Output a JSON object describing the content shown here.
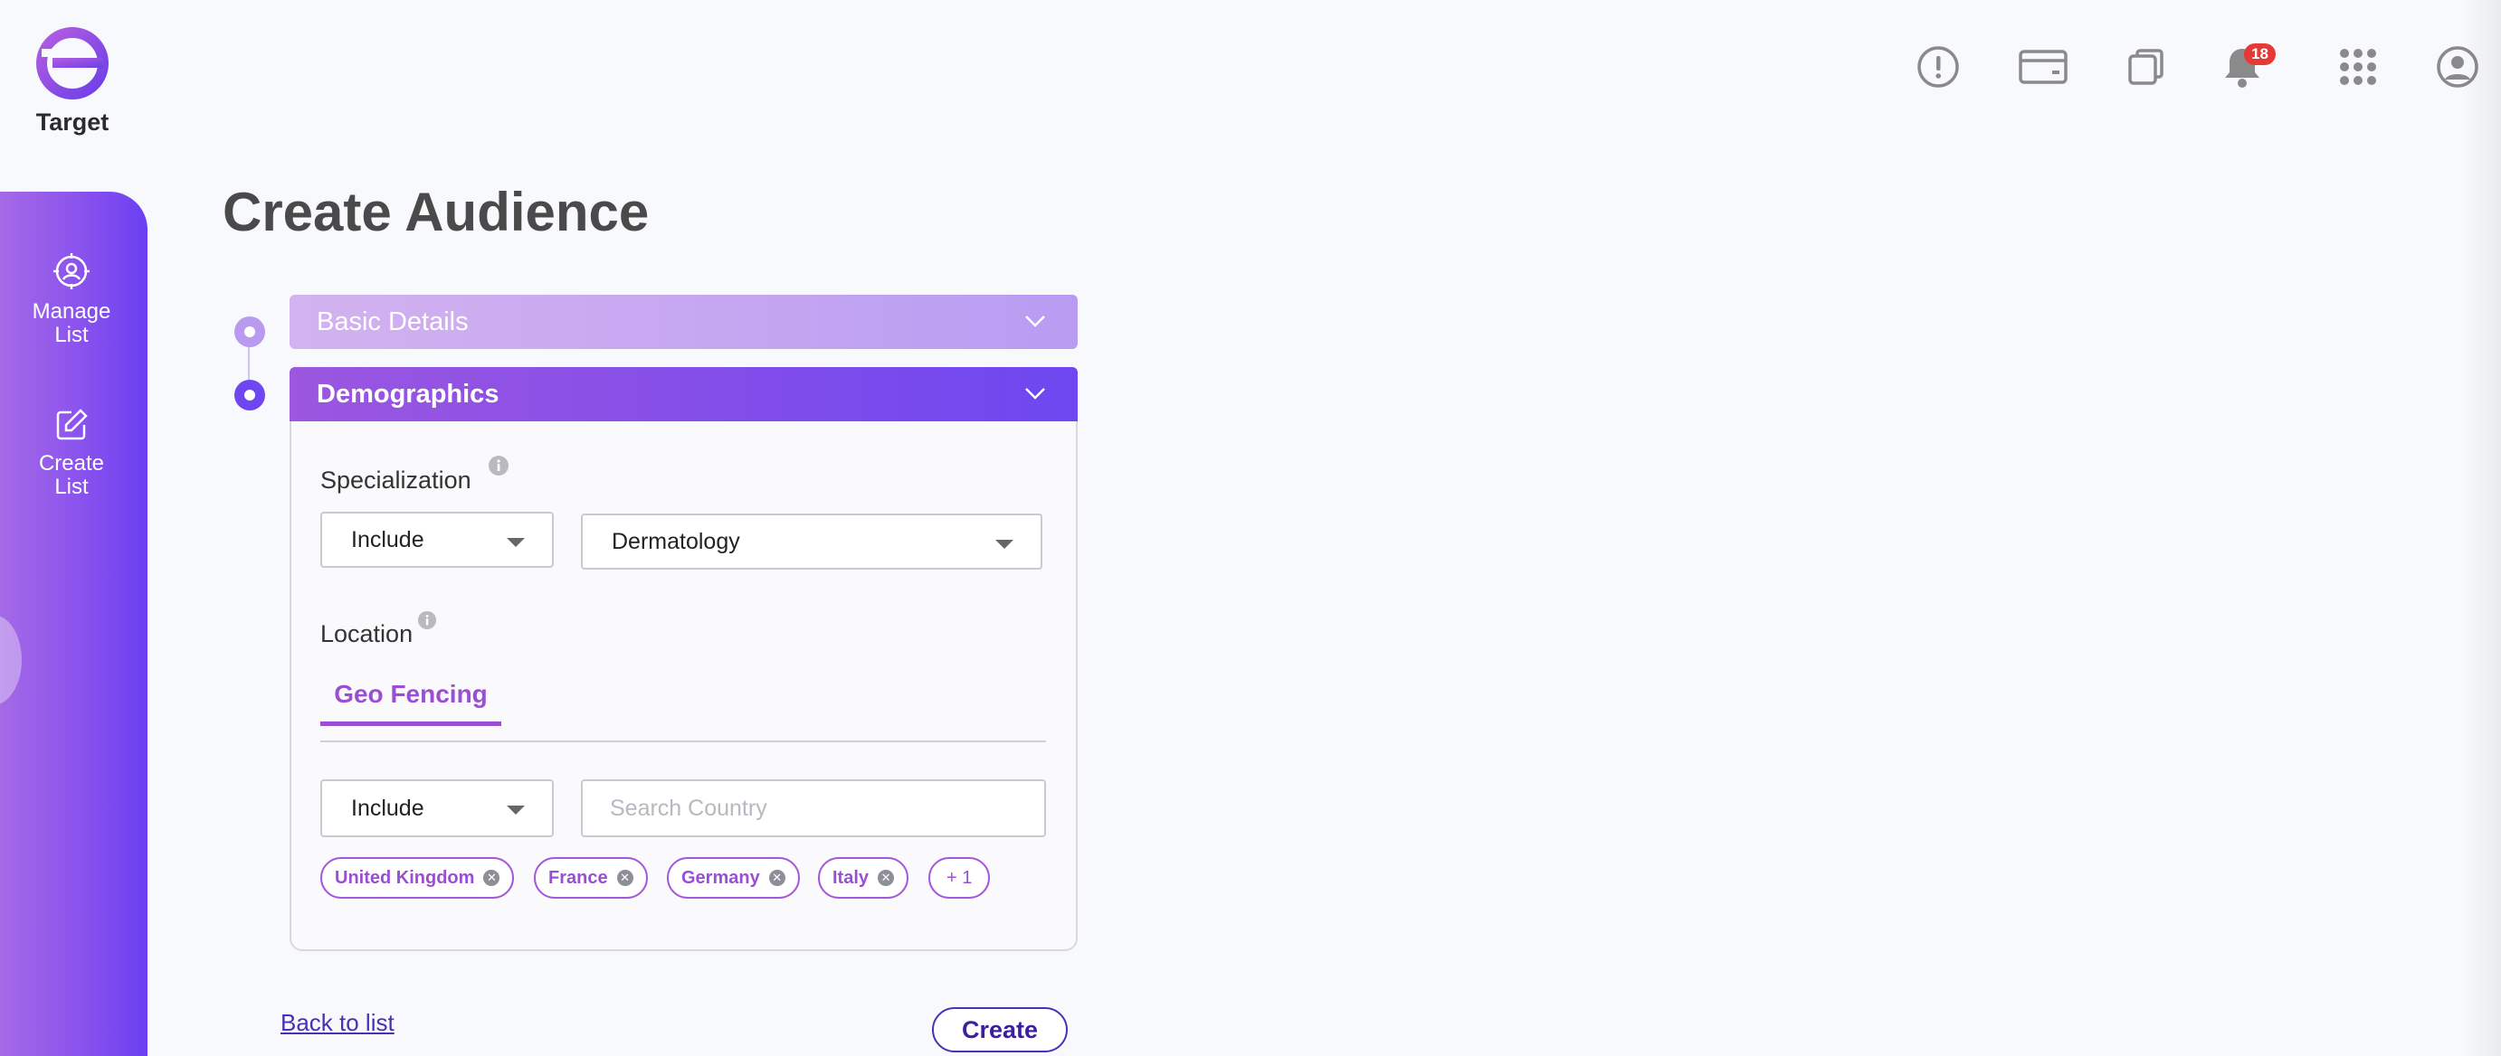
{
  "brand": {
    "name": "Target",
    "logo_icon": "g-logo-icon"
  },
  "topbar": {
    "icons": [
      "alert-icon",
      "card-icon",
      "windows-icon",
      "bell-icon",
      "apps-grid-icon",
      "user-avatar-icon"
    ],
    "notification_count": "18"
  },
  "sidebar": {
    "items": [
      {
        "label_line1": "Manage",
        "label_line2": "List",
        "icon": "target-user-icon"
      },
      {
        "label_line1": "Create",
        "label_line2": "List",
        "icon": "edit-icon"
      }
    ]
  },
  "page": {
    "title": "Create Audience"
  },
  "sections": {
    "basic": {
      "title": "Basic Details"
    },
    "demographics": {
      "title": "Demographics"
    }
  },
  "specialization": {
    "label": "Specialization",
    "mode": "Include",
    "value": "Dermatology"
  },
  "location": {
    "label": "Location",
    "tab": "Geo Fencing",
    "mode": "Include",
    "search_placeholder": "Search Country",
    "chips": [
      "United Kingdom",
      "France",
      "Germany",
      "Italy"
    ],
    "more": "+ 1"
  },
  "actions": {
    "back": "Back to list",
    "create": "Create"
  },
  "colors": {
    "accent": "#9a4fd3",
    "primary": "#6e47f0",
    "badge": "#e53935"
  }
}
